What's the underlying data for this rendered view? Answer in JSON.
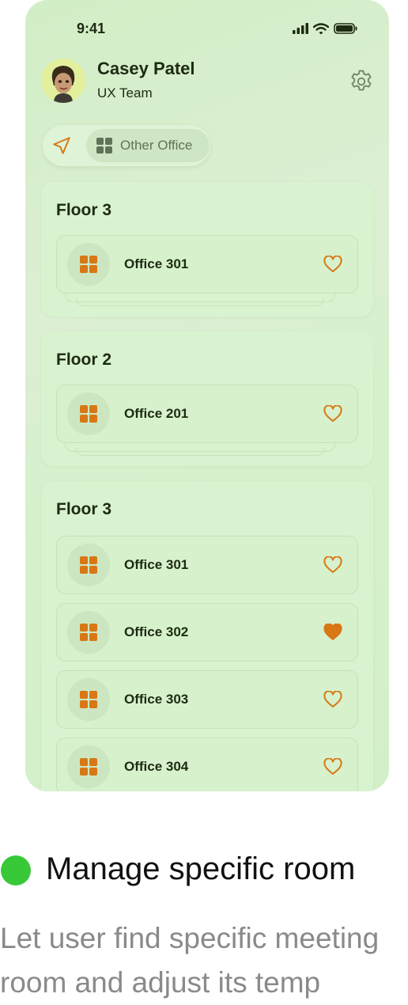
{
  "status_bar": {
    "time": "9:41"
  },
  "profile": {
    "name": "Casey Patel",
    "team": "UX Team"
  },
  "location_toggle": {
    "selected_label": "Other Office"
  },
  "floors": [
    {
      "title": "Floor 3",
      "rooms": [
        {
          "name": "Office 301",
          "favorite": false
        }
      ]
    },
    {
      "title": "Floor 2",
      "rooms": [
        {
          "name": "Office 201",
          "favorite": false
        }
      ]
    },
    {
      "title": "Floor 3",
      "rooms": [
        {
          "name": "Office 301",
          "favorite": false
        },
        {
          "name": "Office 302",
          "favorite": true
        },
        {
          "name": "Office 303",
          "favorite": false
        },
        {
          "name": "Office 304",
          "favorite": false
        }
      ]
    }
  ],
  "caption": {
    "title": "Manage specific room",
    "body": "Let user find specific meeting room and adjust its temp"
  },
  "colors": {
    "accent": "#d87714",
    "dark": "#1d2a12",
    "caption_dot": "#38c838"
  },
  "icons": [
    "signal-icon",
    "wifi-icon",
    "battery-icon",
    "gear-icon",
    "navigation-arrow-icon",
    "grid-icon",
    "heart-icon"
  ]
}
